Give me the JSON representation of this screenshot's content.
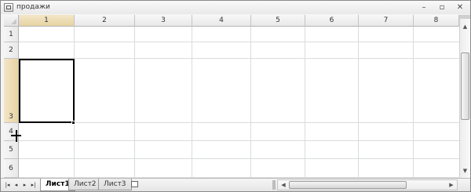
{
  "window": {
    "title": "продажи",
    "minimize_glyph": "–",
    "restore_glyph": "▫",
    "close_glyph": "✕"
  },
  "columns": [
    "1",
    "2",
    "3",
    "4",
    "5",
    "6",
    "7",
    "8"
  ],
  "rows": [
    "1",
    "2",
    "3",
    "4",
    "5",
    "6"
  ],
  "selected_cell": "R3C1",
  "icons": {
    "app": "workbook-icon",
    "select_all": "select-all-triangle-icon",
    "cursor": "row-resize-cursor-icon",
    "insert_sheet": "insert-worksheet-icon"
  },
  "sheet_nav": {
    "first": "|◂",
    "prev": "◂",
    "next": "▸",
    "last": "▸|"
  },
  "sheets": [
    {
      "label": "Лист1",
      "active": true
    },
    {
      "label": "Лист2",
      "active": false
    },
    {
      "label": "Лист3",
      "active": false
    }
  ],
  "scroll": {
    "up": "▲",
    "down": "▼",
    "left": "◀",
    "right": "▶"
  },
  "colors": {
    "selection_border": "#000000",
    "gridline": "#dadcdd",
    "header_bg": "#e8e8e8"
  }
}
